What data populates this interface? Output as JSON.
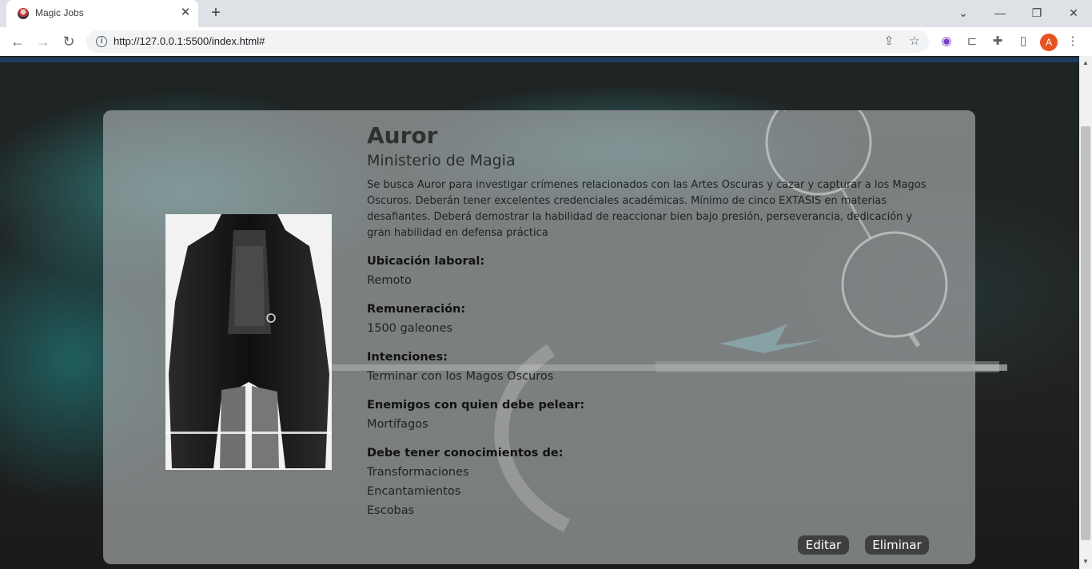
{
  "browser": {
    "tab_title": "Magic Jobs",
    "tab_close": "✕",
    "new_tab": "+",
    "url": "http://127.0.0.1:5500/index.html#",
    "profile_initial": "A",
    "window_controls": {
      "tabs_menu": "⌄",
      "minimize": "—",
      "restore": "❐",
      "close": "✕"
    }
  },
  "job": {
    "title": "Auror",
    "company": "Ministerio de Magia",
    "description": "Se busca Auror para investigar crímenes relacionados con las Artes Oscuras y cazar y capturar a los Magos Oscuros. Deberán tener excelentes credenciales académicas. Mínimo de cinco EXTASIS en materias desafiantes. Deberá demostrar la habilidad de reaccionar bien bajo presión, perseverancia, dedicación y gran habilidad en defensa práctica",
    "location_label": "Ubicación laboral:",
    "location": "Remoto",
    "salary_label": "Remuneración:",
    "salary": "1500 galeones",
    "intentions_label": "Intenciones:",
    "intentions": "Terminar con los Magos Oscuros",
    "enemies_label": "Enemigos con quien debe pelear:",
    "enemies": "Mortífagos",
    "skills_label": "Debe tener conocimientos de:",
    "skills": [
      "Transformaciones",
      "Encantamientos",
      "Escobas"
    ]
  },
  "actions": {
    "edit_label": "Editar",
    "delete_label": "Eliminar"
  },
  "colors": {
    "card_bg": "#a0a3a5",
    "button_bg": "#3f3f3f",
    "accent_teal": "#359a96",
    "header_strip": "#1d3b5c"
  }
}
